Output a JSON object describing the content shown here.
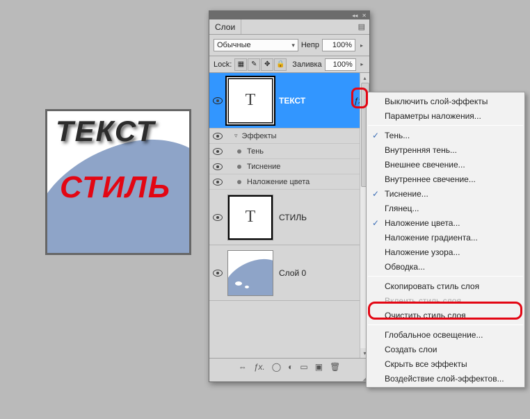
{
  "canvas": {
    "text1": "ТЕКСТ",
    "text2": "СТИЛЬ"
  },
  "panel": {
    "title": "Слои",
    "blend_mode": "Обычные",
    "opacity_label": "Непр",
    "opacity_value": "100%",
    "lock_label": "Lock:",
    "fill_label": "Заливка",
    "fill_value": "100%",
    "layers": [
      {
        "name": "ТЕКСТ",
        "selected": true,
        "has_fx": true,
        "effects_header": "Эффекты",
        "effects": [
          "Тень",
          "Тиснение",
          "Наложение цвета"
        ]
      },
      {
        "name": "СТИЛЬ",
        "selected": false
      },
      {
        "name": "Слой 0",
        "selected": false
      }
    ],
    "footer_icons": [
      "link",
      "fx",
      "mask",
      "adjust",
      "group",
      "new",
      "trash"
    ]
  },
  "menu": {
    "groups": [
      [
        {
          "label": "Выключить слой-эффекты",
          "checked": false
        },
        {
          "label": "Параметры наложения...",
          "checked": false
        }
      ],
      [
        {
          "label": "Тень...",
          "checked": true
        },
        {
          "label": "Внутренняя тень...",
          "checked": false
        },
        {
          "label": "Внешнее свечение...",
          "checked": false
        },
        {
          "label": "Внутреннее свечение...",
          "checked": false
        },
        {
          "label": "Тиснение...",
          "checked": true
        },
        {
          "label": "Глянец...",
          "checked": false
        },
        {
          "label": "Наложение цвета...",
          "checked": true
        },
        {
          "label": "Наложение градиента...",
          "checked": false
        },
        {
          "label": "Наложение узора...",
          "checked": false
        },
        {
          "label": "Обводка...",
          "checked": false
        }
      ],
      [
        {
          "label": "Скопировать стиль слоя",
          "checked": false,
          "highlight": true
        },
        {
          "label": "Вклеить стиль слоя",
          "checked": false,
          "disabled": true
        },
        {
          "label": "Очистить стиль слоя",
          "checked": false
        }
      ],
      [
        {
          "label": "Глобальное освещение...",
          "checked": false
        },
        {
          "label": "Создать слои",
          "checked": false
        },
        {
          "label": "Скрыть все эффекты",
          "checked": false
        },
        {
          "label": "Воздействие слой-эффектов...",
          "checked": false
        }
      ]
    ]
  }
}
